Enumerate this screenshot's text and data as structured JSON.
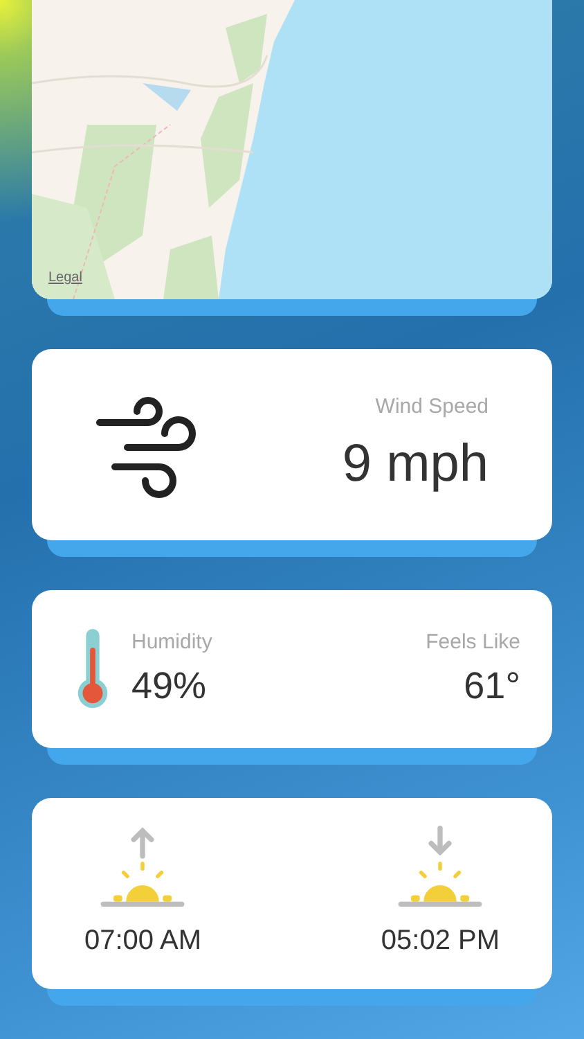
{
  "map": {
    "kind": "picture",
    "legal_link": "Legal"
  },
  "wind": {
    "label": "Wind Speed",
    "value": "9 mph"
  },
  "conditions": {
    "humidity_label": "Humidity",
    "humidity_value": "49%",
    "feels_like_label": "Feels Like",
    "feels_like_value": "61°"
  },
  "sun_times": [
    {
      "kind": "sunrise",
      "time": "07:00 AM"
    },
    {
      "kind": "sunset",
      "time": "05:02 PM"
    }
  ]
}
